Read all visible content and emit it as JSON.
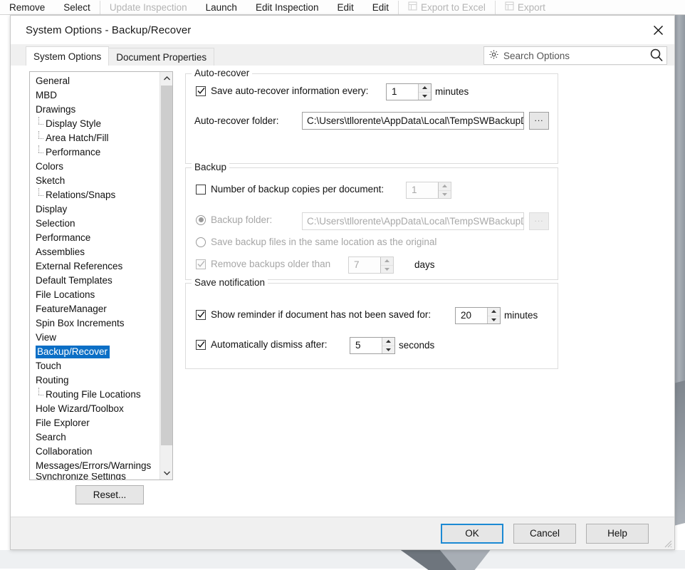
{
  "app_toolbar": {
    "items": [
      {
        "label": "Remove",
        "disabled": false,
        "icon": null
      },
      {
        "label": "Select",
        "disabled": false,
        "icon": null
      },
      {
        "label": "Update Inspection",
        "disabled": true,
        "icon": null
      },
      {
        "label": "Launch",
        "disabled": false,
        "icon": null
      },
      {
        "label": "Edit Inspection",
        "disabled": false,
        "icon": null
      },
      {
        "label": "Edit",
        "disabled": false,
        "icon": null
      },
      {
        "label": "Edit",
        "disabled": false,
        "icon": null
      },
      {
        "label": "Export to Excel",
        "disabled": true,
        "icon": "export-excel-icon"
      },
      {
        "label": "Export",
        "disabled": true,
        "icon": "export-icon"
      }
    ]
  },
  "dialog": {
    "title": "System Options - Backup/Recover",
    "close_icon": "close-icon"
  },
  "tabs": [
    {
      "label": "System Options",
      "active": true
    },
    {
      "label": "Document Properties",
      "active": false
    }
  ],
  "search": {
    "placeholder": "Search Options",
    "value": "",
    "left_icon": "gear-icon",
    "right_icon": "search-icon"
  },
  "tree": {
    "selected": "Backup/Recover",
    "items": [
      {
        "label": "General",
        "level": 0
      },
      {
        "label": "MBD",
        "level": 0
      },
      {
        "label": "Drawings",
        "level": 0
      },
      {
        "label": "Display Style",
        "level": 1
      },
      {
        "label": "Area Hatch/Fill",
        "level": 1
      },
      {
        "label": "Performance",
        "level": 1
      },
      {
        "label": "Colors",
        "level": 0
      },
      {
        "label": "Sketch",
        "level": 0
      },
      {
        "label": "Relations/Snaps",
        "level": 1
      },
      {
        "label": "Display",
        "level": 0
      },
      {
        "label": "Selection",
        "level": 0
      },
      {
        "label": "Performance",
        "level": 0
      },
      {
        "label": "Assemblies",
        "level": 0
      },
      {
        "label": "External References",
        "level": 0
      },
      {
        "label": "Default Templates",
        "level": 0
      },
      {
        "label": "File Locations",
        "level": 0
      },
      {
        "label": "FeatureManager",
        "level": 0
      },
      {
        "label": "Spin Box Increments",
        "level": 0
      },
      {
        "label": "View",
        "level": 0
      },
      {
        "label": "Backup/Recover",
        "level": 0
      },
      {
        "label": "Touch",
        "level": 0
      },
      {
        "label": "Routing",
        "level": 0
      },
      {
        "label": "Routing File Locations",
        "level": 1
      },
      {
        "label": "Hole Wizard/Toolbox",
        "level": 0
      },
      {
        "label": "File Explorer",
        "level": 0
      },
      {
        "label": "Search",
        "level": 0
      },
      {
        "label": "Collaboration",
        "level": 0
      },
      {
        "label": "Messages/Errors/Warnings",
        "level": 0
      },
      {
        "label": "Synchronize Settings",
        "level": 0
      }
    ]
  },
  "reset": {
    "label": "Reset..."
  },
  "auto_recover": {
    "group_title": "Auto-recover",
    "save_checkbox": {
      "label": "Save auto-recover information every:",
      "checked": true,
      "enabled": true
    },
    "interval_value": "1",
    "interval_unit": "minutes",
    "folder_label": "Auto-recover folder:",
    "folder_value": "C:\\Users\\tllorente\\AppData\\Local\\TempSWBackupDir",
    "browse_label": "...",
    "browse_enabled": true
  },
  "backup": {
    "group_title": "Backup",
    "copies_checkbox": {
      "label": "Number of backup copies per document:",
      "checked": false,
      "enabled": true
    },
    "copies_value": "1",
    "folder_radio": {
      "label": "Backup folder:",
      "selected": true,
      "enabled": false
    },
    "folder_value": "C:\\Users\\tllorente\\AppData\\Local\\TempSWBackupDir",
    "browse_label": "...",
    "browse_enabled": false,
    "same_location_radio": {
      "label": "Save backup files in the same location as the original",
      "selected": false,
      "enabled": false
    },
    "remove_checkbox": {
      "label": "Remove backups older than",
      "checked": true,
      "enabled": false
    },
    "remove_value": "7",
    "remove_unit": "days"
  },
  "save_notification": {
    "group_title": "Save notification",
    "reminder_checkbox": {
      "label": "Show reminder if document has not been saved for:",
      "checked": true,
      "enabled": true
    },
    "reminder_value": "20",
    "reminder_unit": "minutes",
    "dismiss_checkbox": {
      "label": "Automatically dismiss after:",
      "checked": true,
      "enabled": true
    },
    "dismiss_value": "5",
    "dismiss_unit": "seconds"
  },
  "footer": {
    "ok": "OK",
    "cancel": "Cancel",
    "help": "Help",
    "default_button": "OK",
    "focus_color": "#1c8ad4"
  },
  "colors": {
    "selection_blue": "#0b6fc6",
    "dialog_bg": "#ffffff",
    "footer_bg": "#f0f0f0",
    "group_border": "#dcdcdc"
  }
}
